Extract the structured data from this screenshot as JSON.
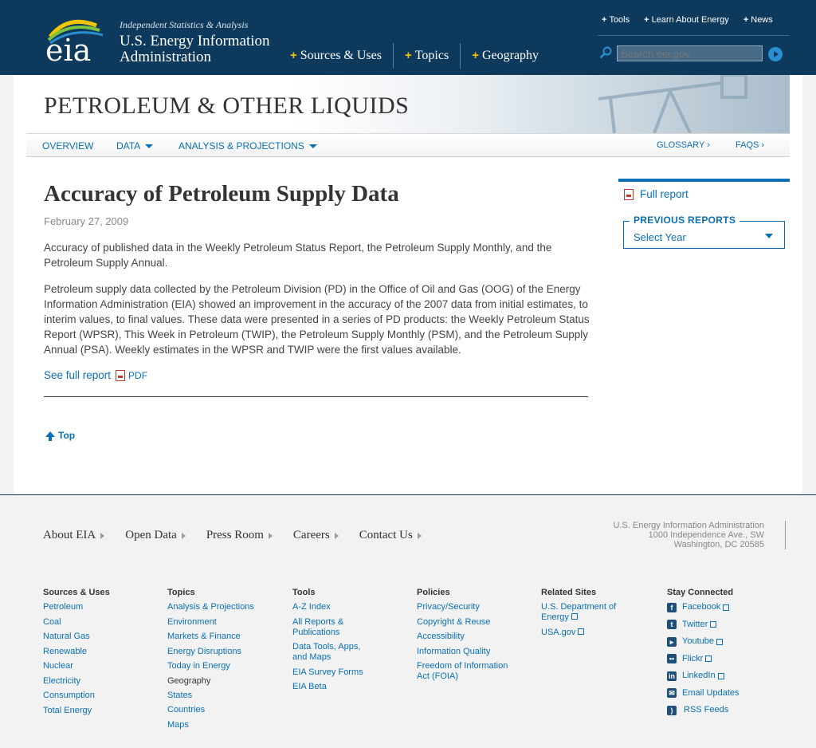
{
  "header": {
    "logo_text": "eia",
    "tagline": "Independent Statistics & Analysis",
    "org_name": "U.S. Energy Information Administration",
    "top_links": [
      "Tools",
      "Learn About Energy",
      "News"
    ],
    "main_nav": [
      "Sources & Uses",
      "Topics",
      "Geography"
    ],
    "search_placeholder": "Search eia.gov"
  },
  "section": {
    "title": "PETROLEUM & OTHER LIQUIDS",
    "subnav": {
      "overview": "OVERVIEW",
      "data": "DATA",
      "analysis": "ANALYSIS & PROJECTIONS",
      "glossary": "GLOSSARY ›",
      "faqs": "FAQS ›"
    }
  },
  "article": {
    "title": "Accuracy of Petroleum Supply Data",
    "date": "February 27, 2009",
    "para1": "Accuracy of published data in the Weekly Petroleum Status Report, the Petroleum Supply Monthly, and the Petroleum Supply Annual.",
    "para2": "Petroleum supply data collected by the Petroleum Division (PD) in the Office of Oil and Gas (OOG) of the Energy Information Administration (EIA) showed an improvement in the accuracy of the 2007 data from initial estimates, to interim values, to final values. These data were presented in a series of PD products: the Weekly Petroleum Status Report (WPSR), This Week in Petroleum (TWIP), the Petroleum Supply Monthly (PSM), and the Petroleum Supply Annual (PSA). Weekly estimates in the WPSR and TWIP were the first values available.",
    "full_report_link": "See full report",
    "pdf_label": "PDF",
    "top_link": "Top"
  },
  "sidebar": {
    "full_report": "Full report",
    "previous_reports_label": "PREVIOUS REPORTS",
    "select_value": "Select Year"
  },
  "footer": {
    "links": [
      "About EIA",
      "Open Data",
      "Press Room",
      "Careers",
      "Contact Us"
    ],
    "address": [
      "U.S. Energy Information Administration",
      "1000 Independence Ave., SW",
      "Washington, DC 20585"
    ],
    "columns": {
      "sources": {
        "heading": "Sources & Uses",
        "items": [
          "Petroleum",
          "Coal",
          "Natural Gas",
          "Renewable",
          "Nuclear",
          "Electricity",
          "Consumption",
          "Total Energy"
        ]
      },
      "topics": {
        "heading": "Topics",
        "items": [
          "Analysis & Projections",
          "Environment",
          "Markets & Finance",
          "Energy Disruptions",
          "Today in Energy"
        ],
        "subheading": "Geography",
        "subitems": [
          "States",
          "Countries",
          "Maps"
        ]
      },
      "tools": {
        "heading": "Tools",
        "items": [
          "A-Z Index",
          "All Reports & Publications",
          "Data Tools, Apps, and Maps",
          "EIA Survey Forms",
          "EIA Beta"
        ]
      },
      "policies": {
        "heading": "Policies",
        "items": [
          "Privacy/Security",
          "Copyright & Reuse",
          "Accessibility",
          "Information Quality",
          "Freedom of Information Act (FOIA)"
        ]
      },
      "related": {
        "heading": "Related Sites",
        "items": [
          "U.S. Department of Energy",
          "USA.gov"
        ]
      },
      "connected": {
        "heading": "Stay Connected",
        "items": [
          "Facebook",
          "Twitter",
          "Youtube",
          "Flickr",
          "LinkedIn",
          "Email Updates",
          "RSS Feeds"
        ]
      }
    }
  }
}
